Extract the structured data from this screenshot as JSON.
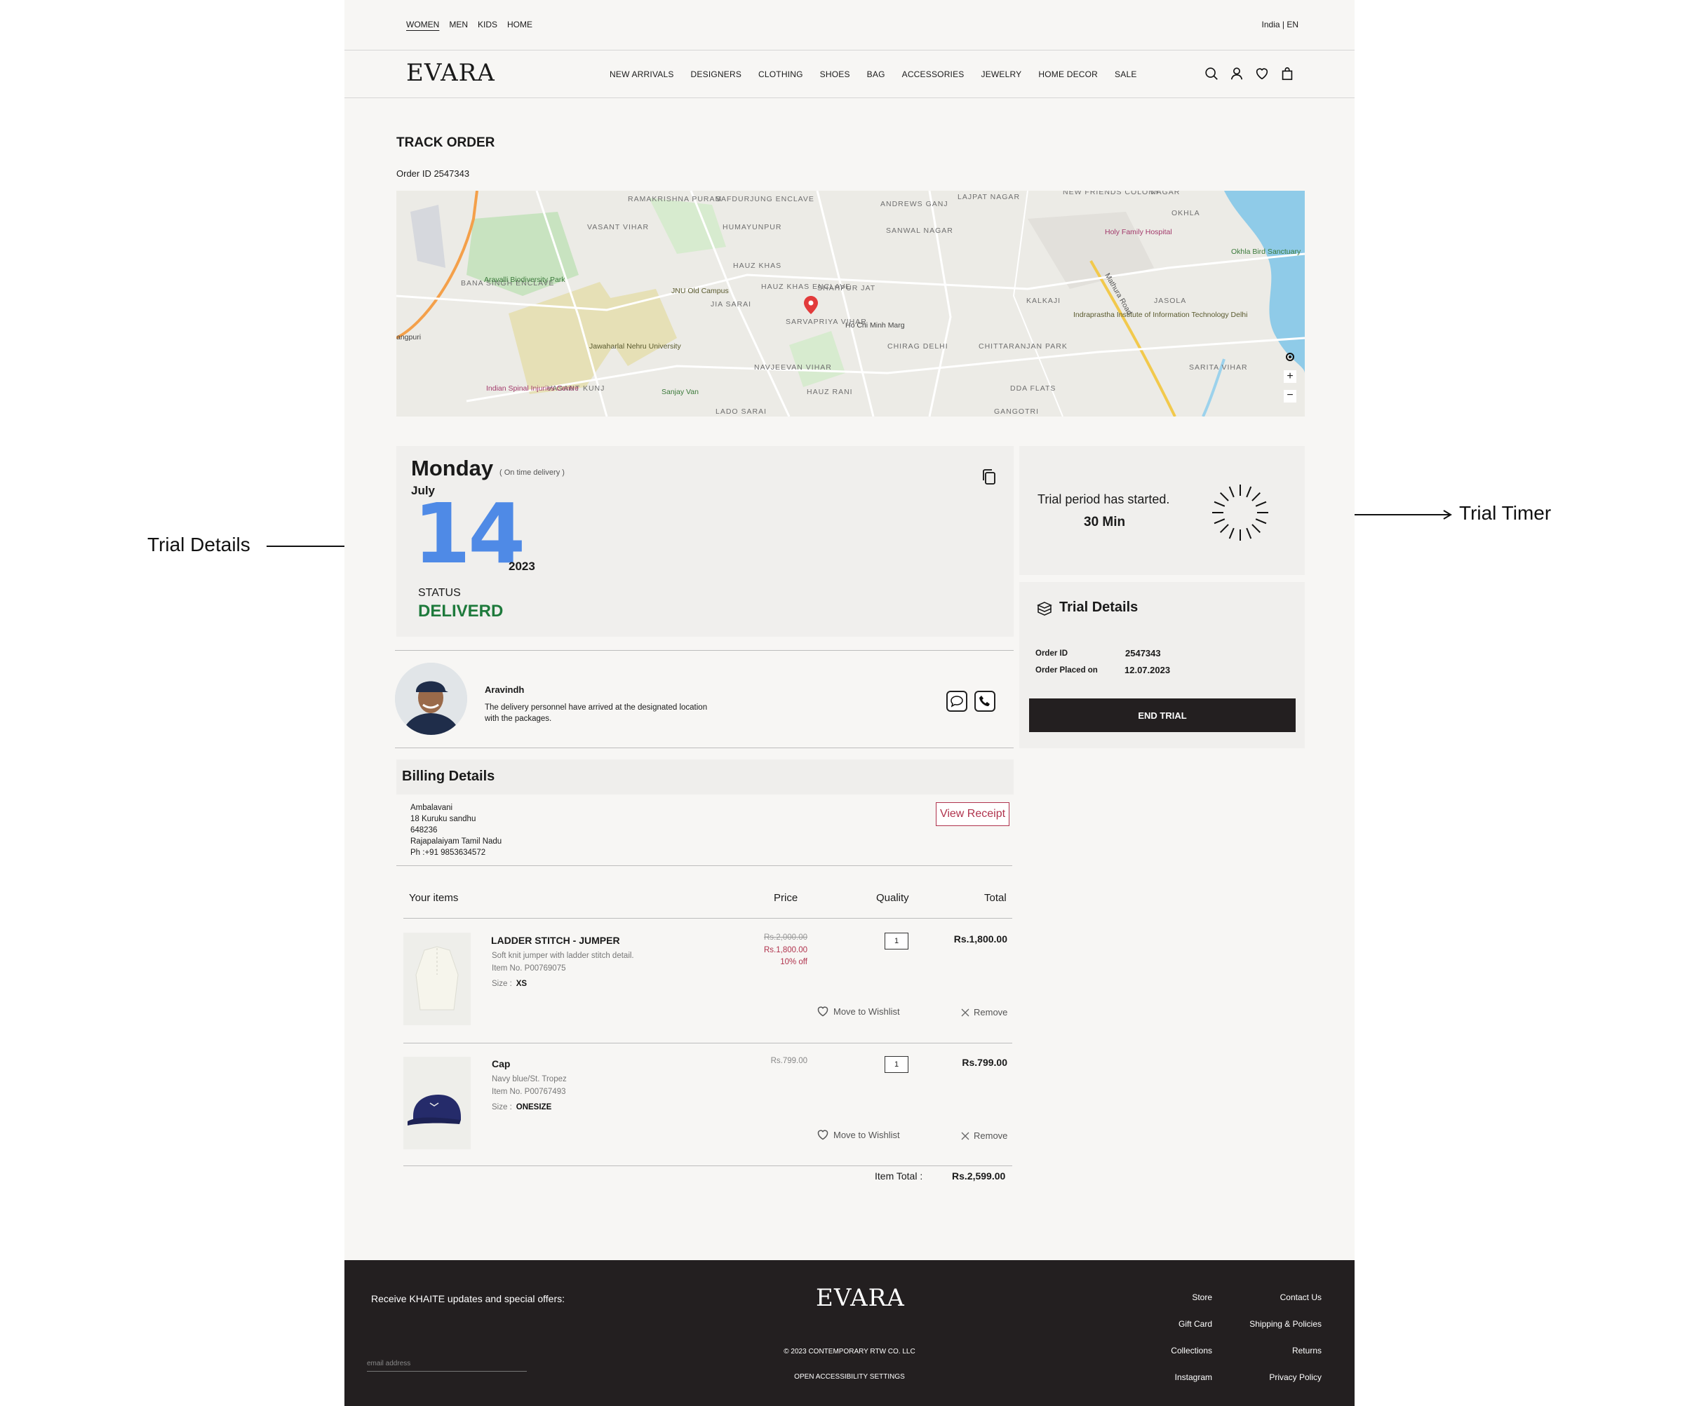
{
  "top_nav": {
    "links": [
      "WOMEN",
      "MEN",
      "KIDS",
      "HOME"
    ],
    "locale": "India | EN"
  },
  "main_nav": {
    "logo": "EVARA",
    "menu": [
      "NEW ARRIVALS",
      "DESIGNERS",
      "CLOTHING",
      "SHOES",
      "BAG",
      "ACCESSORIES",
      "JEWELRY",
      "HOME DECOR",
      "SALE"
    ],
    "icons": [
      "search-icon",
      "user-icon",
      "heart-icon",
      "bag-icon"
    ]
  },
  "page": {
    "title": "TRACK ORDER",
    "order_id": "Order ID 2547343"
  },
  "map": {
    "labels": [
      "RAMAKRISHNA PURAM",
      "SAFDURJUNG ENCLAVE",
      "ANDREWS GANJ",
      "LAJPAT NAGAR",
      "NEW FRIENDS COLONY",
      "NAGAR",
      "OKHLA",
      "VASANT VIHAR",
      "HUMAYUNPUR",
      "SANWAL NAGAR",
      "Holy Family Hospital",
      "Okhla Bird Sanctuary",
      "Aravalli Biodiversity Park",
      "HAUZ KHAS",
      "BANA SINGH ENCLAVE",
      "JNU Old Campus",
      "HAUZ KHAS ENCLAVE",
      "SHAHPUR JAT",
      "KALKAJI",
      "JASOLA",
      "JIA SARAI",
      "SARVAPRIYA VIHAR",
      "Ho Chi Minh Marg",
      "Indraprastha Institute of Information Technology Delhi",
      "angpuri",
      "Jawaharlal Nehru University",
      "CHIRAG DELHI",
      "CHITTARANJAN PARK",
      "SARITA VIHAR",
      "NAVJEEVAN VIHAR",
      "Indian Spinal Injuries Centre",
      "VASANT KUNJ",
      "Sanjay Van",
      "HAUZ RANI",
      "DDA FLATS",
      "LADO SARAI",
      "GANGOTRI",
      "Mathura Road"
    ]
  },
  "delivery": {
    "day": "Monday",
    "note": "( On time delivery )",
    "month": "July",
    "date": "14",
    "year": "2023",
    "status_label": "STATUS",
    "status_value": "DELIVERD"
  },
  "courier": {
    "name": "Aravindh",
    "message": "The delivery personnel have arrived at the designated location with the packages."
  },
  "billing": {
    "title": "Billing Details",
    "address_lines": [
      "Ambalavani",
      "18 Kuruku sandhu",
      "648236",
      "Rajapalaiyam Tamil Nadu",
      "Ph :+91 9853634572"
    ],
    "receipt_label": "View  Receipt"
  },
  "items_table": {
    "headers": [
      "Your items",
      "Price",
      "Quality",
      "Total"
    ],
    "wishlist_label": "Move to Wishlist",
    "remove_label": "Remove",
    "size_label": "Size :",
    "items": [
      {
        "name": "LADDER STITCH - JUMPER",
        "desc": "Soft knit jumper with ladder stitch detail.",
        "item_no": "Item No. P00769075",
        "size": "XS",
        "price_original": "Rs.2,000.00",
        "price_now": "Rs.1,800.00",
        "discount": "10% off",
        "qty": "1",
        "total": "Rs.1,800.00"
      },
      {
        "name": "Cap",
        "desc": "Navy blue/St. Tropez",
        "item_no": "Item No. P00767493",
        "size": "ONESIZE",
        "price_original": "Rs.799.00",
        "qty": "1",
        "total": "Rs.799.00"
      }
    ],
    "total_label": "Item Total :",
    "total_value": "Rs.2,599.00"
  },
  "trial_timer": {
    "text": "Trial period has started.",
    "duration": "30 Min"
  },
  "trial_details": {
    "title": "Trial Details",
    "order_id_label": "Order ID",
    "order_id_value": "2547343",
    "placed_label": "Order Placed on",
    "placed_value": "12.07.2023",
    "end_button": "END TRIAL"
  },
  "footer": {
    "subscribe": "Receive KHAITE updates and special offers:",
    "email_placeholder": "email address",
    "logo": "EVARA",
    "copyright": "© 2023 CONTEMPORARY RTW CO. LLC",
    "accessibility": "OPEN ACCESSIBILITY SETTINGS",
    "links_left": [
      "Store",
      "Gift Card",
      "Collections",
      "Instagram"
    ],
    "links_right": [
      "Contact Us",
      "Shipping & Policies",
      "Returns",
      "Privacy Policy"
    ]
  },
  "annotations": {
    "left": "Trial Details",
    "right": "Trial Timer"
  },
  "colors": {
    "date_blue": "#4f8ae6",
    "status_green": "#1e7a3c",
    "accent_red": "#b0334d",
    "footer_dark": "#231f20"
  }
}
